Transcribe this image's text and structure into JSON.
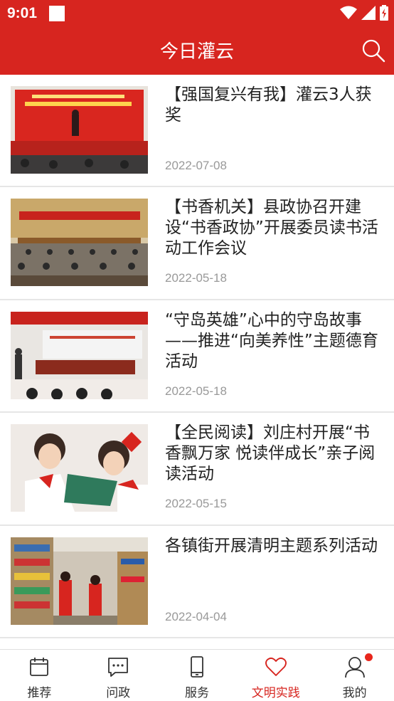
{
  "status_bar": {
    "time": "9:01"
  },
  "app_bar": {
    "title": "今日灌云"
  },
  "articles": [
    {
      "title": "【强国复兴有我】灌云3人获奖",
      "date": "2022-07-08"
    },
    {
      "title": "【书香机关】县政协召开建设“书香政协”开展委员读书活动工作会议",
      "date": "2022-05-18"
    },
    {
      "title": "“守岛英雄”心中的守岛故事——推进“向美养性”主题德育活动",
      "date": "2022-05-18"
    },
    {
      "title": "【全民阅读】刘庄村开展“书香飘万家 悦读伴成长”亲子阅读活动",
      "date": "2022-05-15"
    },
    {
      "title": "各镇街开展清明主题系列活动",
      "date": "2022-04-04"
    }
  ],
  "tab_bar": {
    "tabs": [
      {
        "label": "推荐",
        "icon": "calendar-icon"
      },
      {
        "label": "问政",
        "icon": "chat-icon"
      },
      {
        "label": "服务",
        "icon": "phone-icon"
      },
      {
        "label": "文明实践",
        "icon": "heart-icon"
      },
      {
        "label": "我的",
        "icon": "person-icon"
      }
    ],
    "active_index": 3
  },
  "colors": {
    "brand": "#d7251f",
    "date_gray": "#999999",
    "badge": "#e8261c"
  }
}
